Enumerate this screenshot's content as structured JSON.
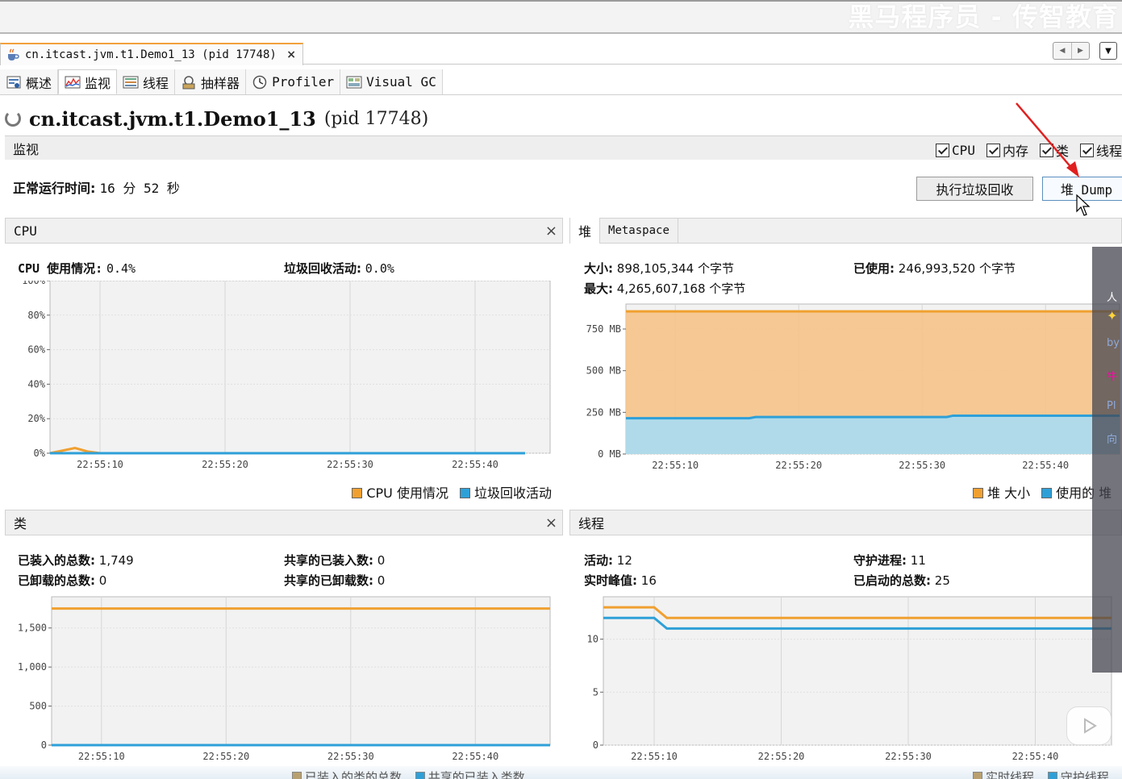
{
  "watermark": "黑马程序员 - 传智教育",
  "document_tab": {
    "label": "cn.itcast.jvm.t1.Demo1_13 (pid 17748)",
    "close": "×"
  },
  "subtabs": [
    {
      "label": "概述",
      "icon": "overview-icon"
    },
    {
      "label": "监视",
      "icon": "monitor-icon"
    },
    {
      "label": "线程",
      "icon": "threads-icon"
    },
    {
      "label": "抽样器",
      "icon": "sampler-icon"
    },
    {
      "label": "Profiler",
      "icon": "profiler-icon"
    },
    {
      "label": "Visual GC",
      "icon": "visual-gc-icon"
    }
  ],
  "app_title": {
    "name": "cn.itcast.jvm.t1.Demo1_13",
    "pid": "(pid 17748)"
  },
  "section": {
    "title": "监视",
    "checkboxes": [
      {
        "label": "CPU",
        "checked": true
      },
      {
        "label": "内存",
        "checked": true
      },
      {
        "label": "类",
        "checked": true
      },
      {
        "label": "线程",
        "checked": true
      }
    ]
  },
  "uptime": {
    "label": "正常运行时间:",
    "value": "16 分 52 秒"
  },
  "buttons": {
    "gc": "执行垃圾回收",
    "heap_dump": "堆 Dump"
  },
  "cpu_panel": {
    "title": "CPU",
    "close": "×",
    "usage_label": "CPU 使用情况:",
    "usage_value": "0.4%",
    "gc_label": "垃圾回收活动:",
    "gc_value": "0.0%",
    "legend": [
      "CPU 使用情况",
      "垃圾回收活动"
    ]
  },
  "heap_panel": {
    "tabs": [
      "堆",
      "Metaspace"
    ],
    "size_label": "大小:",
    "size_value": "898,105,344 个字节",
    "max_label": "最大:",
    "max_value": "4,265,607,168 个字节",
    "used_label": "已使用:",
    "used_value": "246,993,520 个字节",
    "legend": [
      "堆 大小",
      "使用的 堆"
    ]
  },
  "class_panel": {
    "title": "类",
    "close": "×",
    "loaded_label": "已装入的总数:",
    "loaded_value": "1,749",
    "unloaded_label": "已卸载的总数:",
    "unloaded_value": "0",
    "shared_loaded_label": "共享的已装入数:",
    "shared_loaded_value": "0",
    "shared_unloaded_label": "共享的已卸载数:",
    "shared_unloaded_value": "0",
    "legend": [
      "已装入的类的总数",
      "共享的已装入类数"
    ]
  },
  "thread_panel": {
    "title": "线程",
    "live_label": "活动:",
    "live_value": "12",
    "peak_label": "实时峰值:",
    "peak_value": "16",
    "daemon_label": "守护进程:",
    "daemon_value": "11",
    "started_label": "已启动的总数:",
    "started_value": "25",
    "legend": [
      "实时线程",
      "守护线程"
    ]
  },
  "colors": {
    "orange": "#f0a030",
    "blue": "#2ea0d8",
    "orange_fill": "#f6c48a",
    "blue_fill": "#a8dcf3"
  },
  "chart_data": [
    {
      "type": "line",
      "name": "CPU",
      "xticks": [
        "22:55:10",
        "22:55:20",
        "22:55:30",
        "22:55:40"
      ],
      "yticks": [
        "0%",
        "20%",
        "40%",
        "60%",
        "80%",
        "100%"
      ],
      "ylim": [
        0,
        100
      ],
      "x": [
        0,
        2,
        3,
        4,
        38
      ],
      "series": [
        {
          "name": "CPU 使用情况",
          "values": [
            0,
            3,
            1,
            0,
            0
          ]
        },
        {
          "name": "垃圾回收活动",
          "values": [
            0,
            0,
            0,
            0,
            0
          ]
        }
      ]
    },
    {
      "type": "area",
      "name": "堆",
      "xticks": [
        "22:55:10",
        "22:55:20",
        "22:55:30",
        "22:55:40"
      ],
      "yticks": [
        "0 MB",
        "250 MB",
        "500 MB",
        "750 MB"
      ],
      "ylim": [
        0,
        900
      ],
      "x": [
        0,
        10,
        10.5,
        26,
        26.5,
        40
      ],
      "series": [
        {
          "name": "堆 大小",
          "values": [
            856,
            856,
            856,
            856,
            856,
            856
          ]
        },
        {
          "name": "使用的 堆",
          "values": [
            215,
            215,
            222,
            222,
            230,
            230
          ]
        }
      ]
    },
    {
      "type": "line",
      "name": "类",
      "xticks": [
        "22:55:10",
        "22:55:20",
        "22:55:30",
        "22:55:40"
      ],
      "yticks": [
        "0",
        "500",
        "1,000",
        "1,500"
      ],
      "ylim": [
        0,
        1900
      ],
      "x": [
        0,
        40
      ],
      "series": [
        {
          "name": "已装入的类的总数",
          "values": [
            1749,
            1749
          ]
        },
        {
          "name": "共享的已装入类数",
          "values": [
            0,
            0
          ]
        }
      ]
    },
    {
      "type": "line",
      "name": "线程",
      "xticks": [
        "22:55:10",
        "22:55:20",
        "22:55:30",
        "22:55:40"
      ],
      "yticks": [
        "0",
        "5",
        "10"
      ],
      "ylim": [
        0,
        14
      ],
      "x": [
        0,
        4,
        5,
        40
      ],
      "series": [
        {
          "name": "实时线程",
          "values": [
            13,
            13,
            12,
            12
          ]
        },
        {
          "name": "守护线程",
          "values": [
            12,
            12,
            11,
            11
          ]
        }
      ]
    }
  ]
}
